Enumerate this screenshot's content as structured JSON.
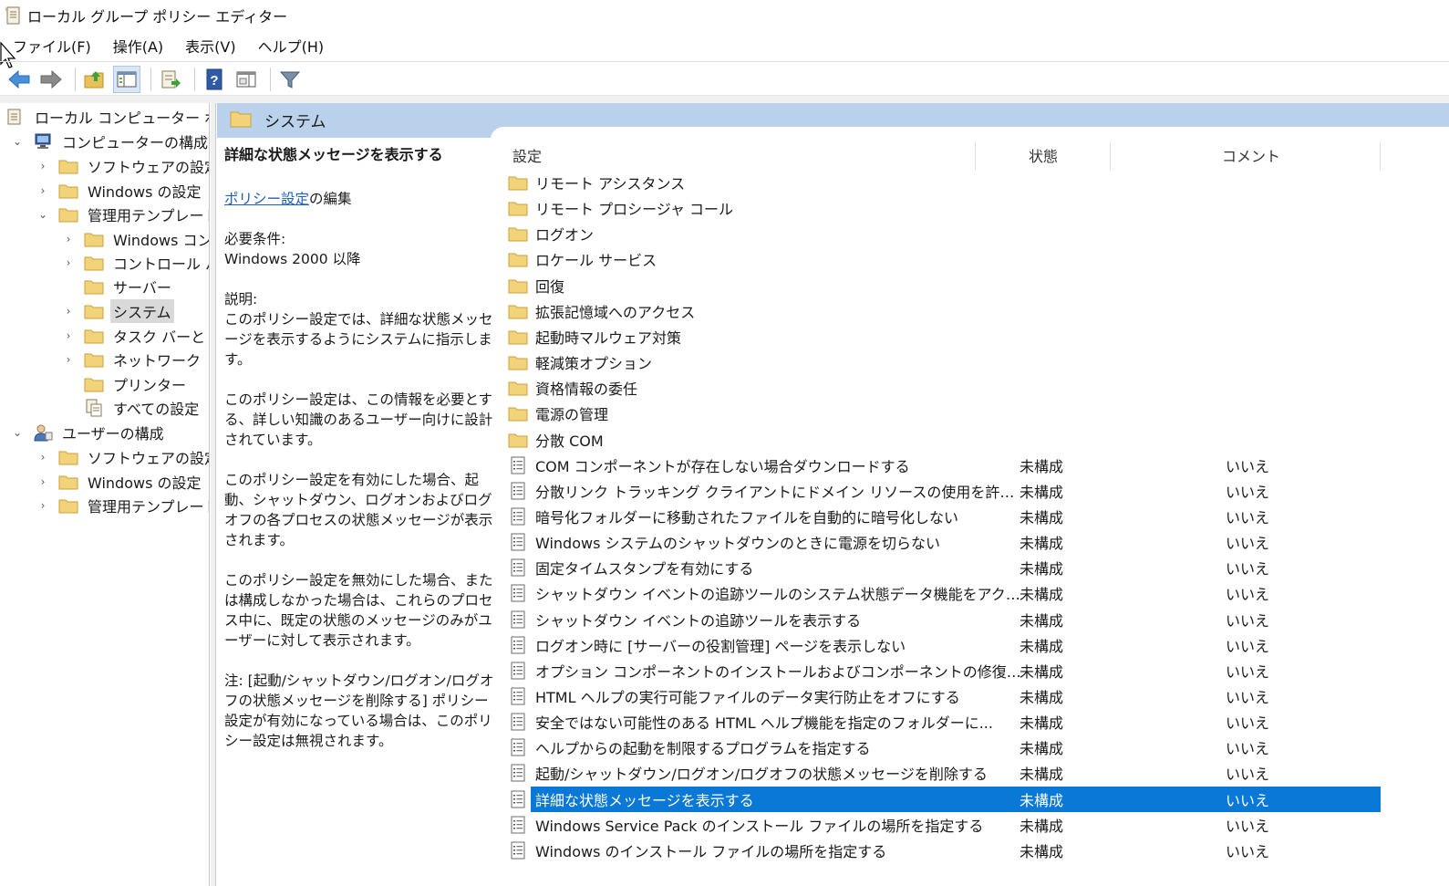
{
  "window": {
    "title": "ローカル グループ ポリシー エディター"
  },
  "menu": [
    "ファイル(F)",
    "操作(A)",
    "表示(V)",
    "ヘルプ(H)"
  ],
  "toolbar": [
    "back-icon",
    "forward-icon",
    "up-folder-icon",
    "show-hide-tree-icon",
    "export-list-icon",
    "help-icon",
    "show-hide-action-pane-icon",
    "filter-icon"
  ],
  "tree": {
    "root": "ローカル コンピューター ポリシー",
    "computer": "コンピューターの構成",
    "computer_children": [
      "ソフトウェアの設定",
      "Windows の設定",
      "管理用テンプレート"
    ],
    "admin_children": [
      "Windows コンポーネント",
      "コントロール パネル",
      "サーバー",
      "システム",
      "タスク バーと [スタート] メニュー",
      "ネットワーク",
      "プリンター",
      "すべての設定"
    ],
    "user": "ユーザーの構成",
    "user_children": [
      "ソフトウェアの設定",
      "Windows の設定",
      "管理用テンプレート"
    ]
  },
  "header": {
    "title": "システム"
  },
  "description": {
    "title": "詳細な状態メッセージを表示する",
    "edit_link": "ポリシー設定",
    "edit_suffix": "の編集",
    "req_label": "必要条件:",
    "req_value": "Windows 2000 以降",
    "explain_label": "説明:",
    "p1": "このポリシー設定では、詳細な状態メッセージを表示するようにシステムに指示します。",
    "p2": "このポリシー設定は、この情報を必要とする、詳しい知識のあるユーザー向けに設計されています。",
    "p3": "このポリシー設定を有効にした場合、起動、シャットダウン、ログオンおよびログオフの各プロセスの状態メッセージが表示されます。",
    "p4": "このポリシー設定を無効にした場合、または構成しなかった場合は、これらのプロセス中に、既定の状態のメッセージのみがユーザーに対して表示されます。",
    "p5": "注: [起動/シャットダウン/ログオン/ログオフの状態メッセージを削除する] ポリシー設定が有効になっている場合は、このポリシー設定は無視されます。"
  },
  "columns": {
    "setting": "設定",
    "state": "状態",
    "comment": "コメント"
  },
  "folders": [
    "リモート アシスタンス",
    "リモート プロシージャ コール",
    "ログオン",
    "ロケール サービス",
    "回復",
    "拡張記憶域へのアクセス",
    "起動時マルウェア対策",
    "軽減策オプション",
    "資格情報の委任",
    "電源の管理",
    "分散 COM"
  ],
  "policies": [
    {
      "name": "COM コンポーネントが存在しない場合ダウンロードする",
      "state": "未構成",
      "comment": "いいえ"
    },
    {
      "name": "分散リンク トラッキング クライアントにドメイン リソースの使用を許可する",
      "state": "未構成",
      "comment": "いいえ"
    },
    {
      "name": "暗号化フォルダーに移動されたファイルを自動的に暗号化しない",
      "state": "未構成",
      "comment": "いいえ"
    },
    {
      "name": "Windows システムのシャットダウンのときに電源を切らない",
      "state": "未構成",
      "comment": "いいえ"
    },
    {
      "name": "固定タイムスタンプを有効にする",
      "state": "未構成",
      "comment": "いいえ"
    },
    {
      "name": "シャットダウン イベントの追跡ツールのシステム状態データ機能をアクテ...",
      "state": "未構成",
      "comment": "いいえ"
    },
    {
      "name": "シャットダウン イベントの追跡ツールを表示する",
      "state": "未構成",
      "comment": "いいえ"
    },
    {
      "name": "ログオン時に [サーバーの役割管理] ページを表示しない",
      "state": "未構成",
      "comment": "いいえ"
    },
    {
      "name": "オプション コンポーネントのインストールおよびコンポーネントの修復のた...",
      "state": "未構成",
      "comment": "いいえ"
    },
    {
      "name": "HTML ヘルプの実行可能ファイルのデータ実行防止をオフにする",
      "state": "未構成",
      "comment": "いいえ"
    },
    {
      "name": "安全ではない可能性のある HTML ヘルプ機能を指定のフォルダーに...",
      "state": "未構成",
      "comment": "いいえ"
    },
    {
      "name": "ヘルプからの起動を制限するプログラムを指定する",
      "state": "未構成",
      "comment": "いいえ"
    },
    {
      "name": "起動/シャットダウン/ログオン/ログオフの状態メッセージを削除する",
      "state": "未構成",
      "comment": "いいえ"
    },
    {
      "name": "詳細な状態メッセージを表示する",
      "state": "未構成",
      "comment": "いいえ"
    },
    {
      "name": "Windows Service Pack のインストール ファイルの場所を指定する",
      "state": "未構成",
      "comment": "いいえ"
    },
    {
      "name": "Windows のインストール ファイルの場所を指定する",
      "state": "未構成",
      "comment": "いいえ"
    }
  ],
  "colors": {
    "selection": "#0a78d7",
    "header_band": "#b9d1ea",
    "link": "#1f5fbf",
    "folder": "#e8c15a"
  }
}
